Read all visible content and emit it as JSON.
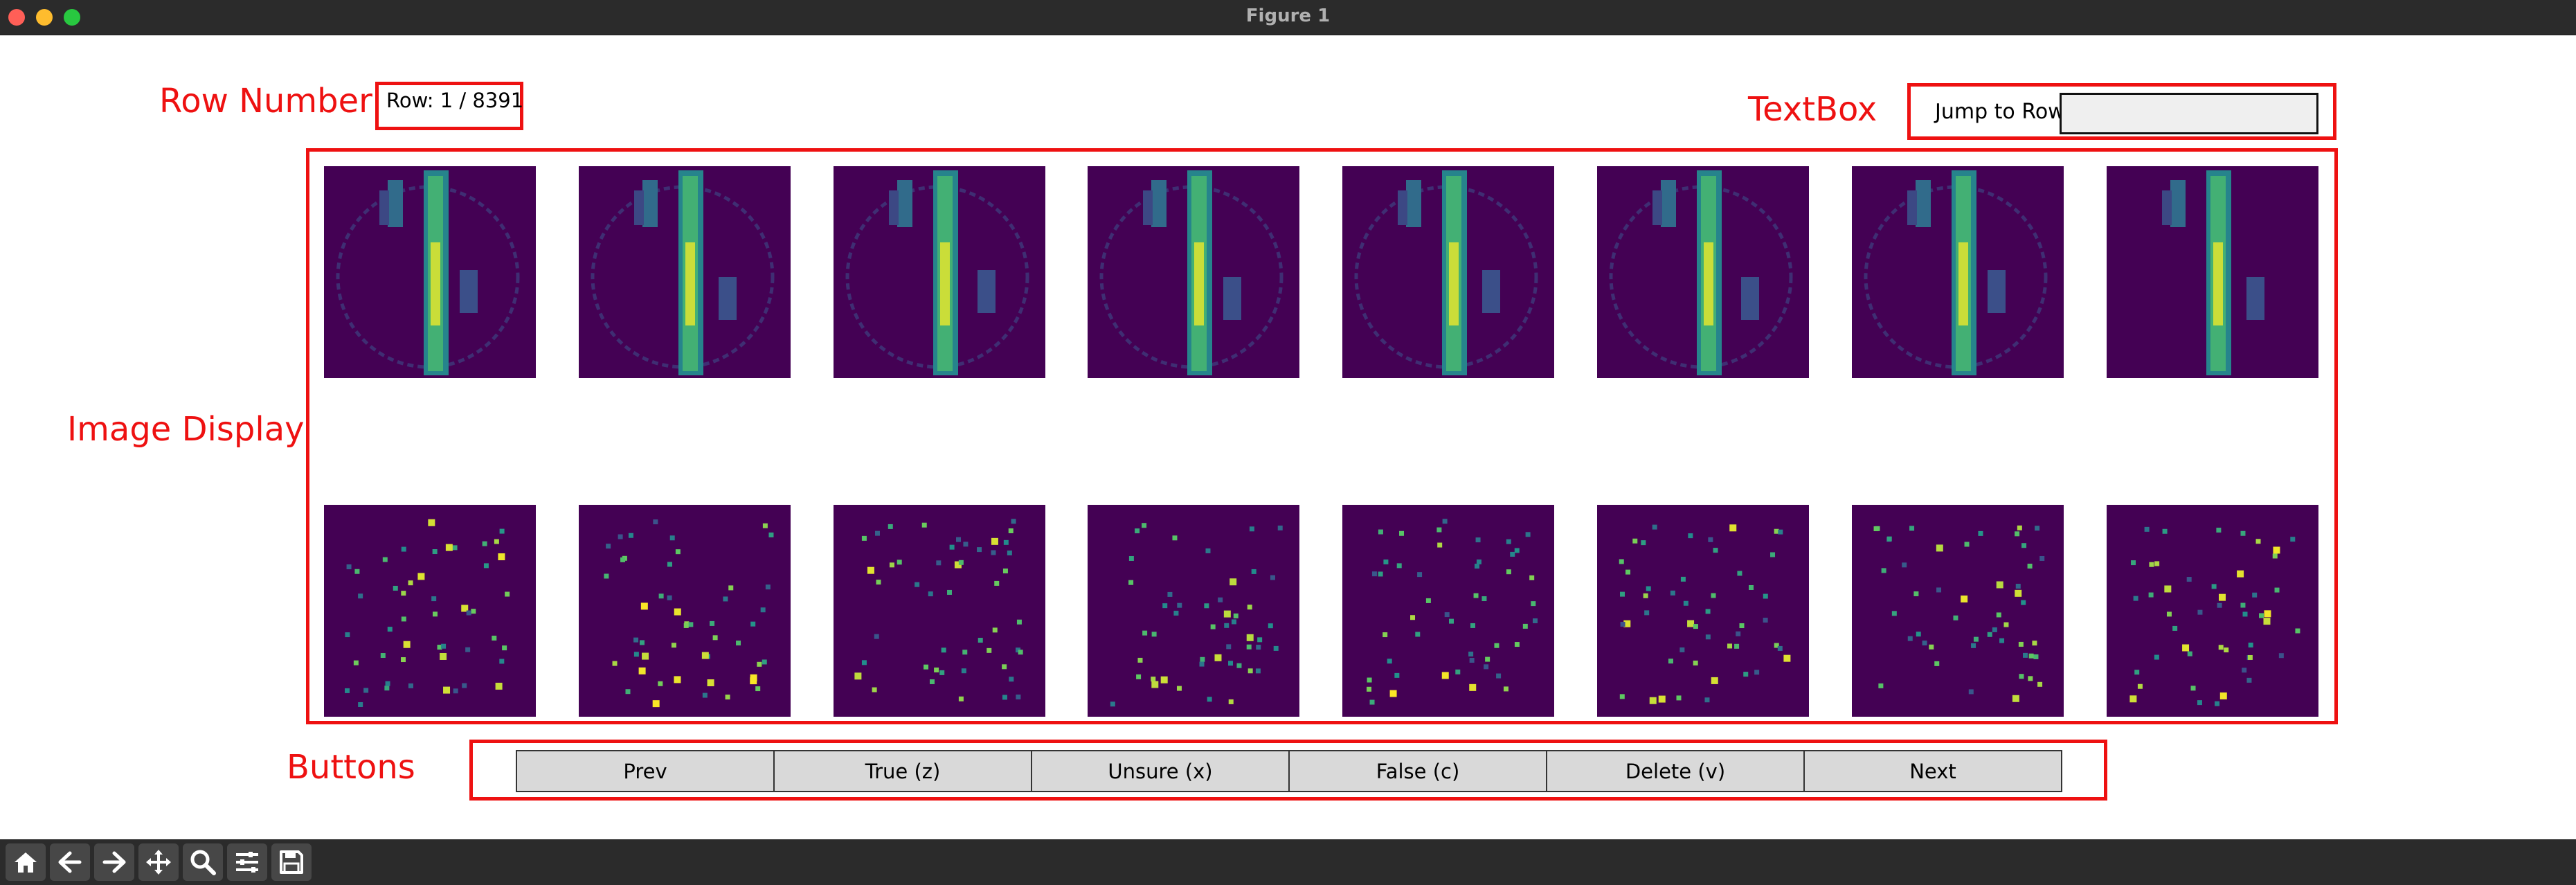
{
  "window": {
    "title": "Figure 1"
  },
  "annotations": {
    "row_number": "Row Number",
    "textbox": "TextBox",
    "image_display": "Image Display",
    "buttons": "Buttons"
  },
  "row_counter": "Row: 1 / 8391",
  "jump": {
    "label": "Jump to Row:",
    "value": ""
  },
  "images": {
    "colormap": "viridis",
    "top_row_count": 8,
    "bottom_row_count": 8
  },
  "buttons": [
    {
      "label": "Prev"
    },
    {
      "label": "True (z)"
    },
    {
      "label": "Unsure (x)"
    },
    {
      "label": "False (c)"
    },
    {
      "label": "Delete (v)"
    },
    {
      "label": "Next"
    }
  ],
  "toolbar": {
    "icons": [
      "home-icon",
      "back-arrow-icon",
      "forward-arrow-icon",
      "pan-icon",
      "zoom-icon",
      "configure-subplots-icon",
      "save-icon"
    ]
  },
  "colors": {
    "annotation": "#ee1111",
    "viridis_low": "#440154",
    "viridis_mid": "#21918c",
    "viridis_high": "#fde725"
  }
}
